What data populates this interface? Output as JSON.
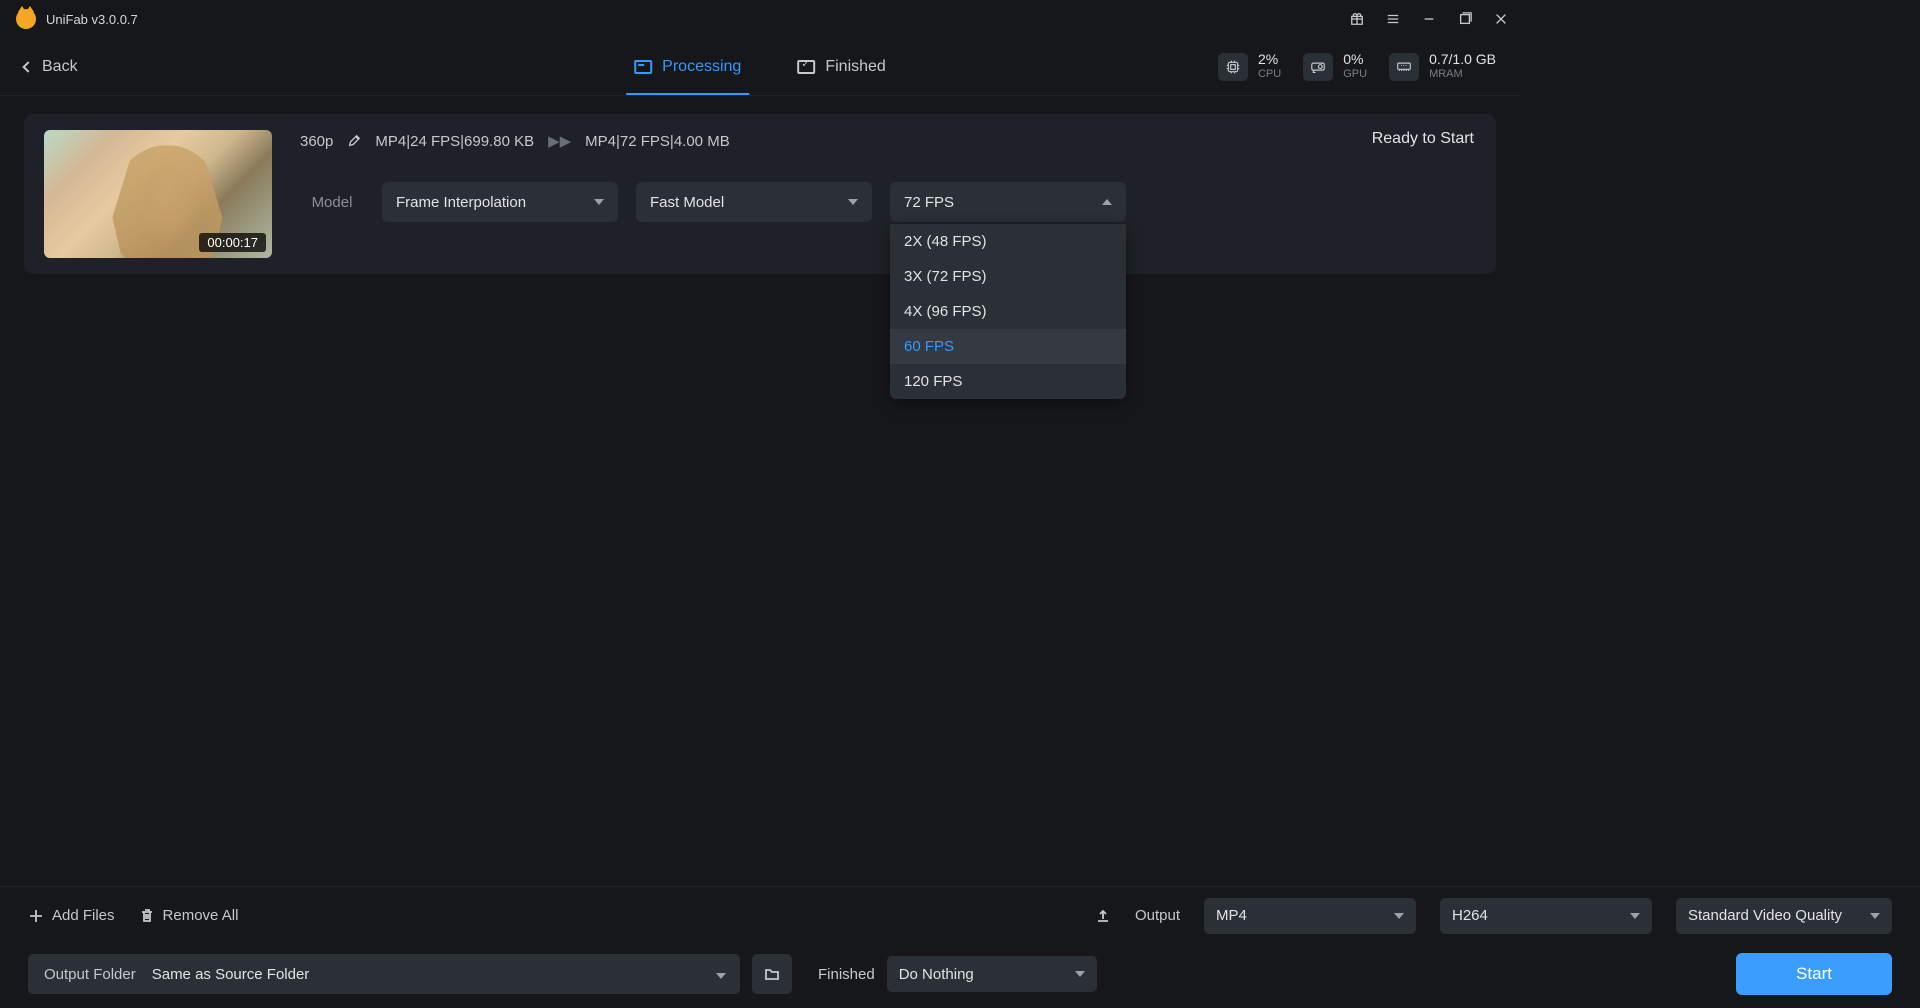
{
  "app_title": "UniFab v3.0.0.7",
  "titlebar_controls": {
    "menu": "≡",
    "minimize": "—",
    "maximize": "⧉",
    "close": "✕"
  },
  "back_label": "Back",
  "tabs": {
    "processing": "Processing",
    "finished": "Finished"
  },
  "stats": {
    "cpu": {
      "value": "2%",
      "label": "CPU"
    },
    "gpu": {
      "value": "0%",
      "label": "GPU"
    },
    "ram": {
      "value": "0.7/1.0 GB",
      "label": "MRAM"
    }
  },
  "card": {
    "duration": "00:00:17",
    "resolution": "360p",
    "source_spec": "MP4|24 FPS|699.80 KB",
    "arrow": "▶▶",
    "target_spec": "MP4|72 FPS|4.00 MB",
    "status": "Ready to Start",
    "model_label": "Model",
    "model_select": "Frame Interpolation",
    "speed_select": "Fast Model",
    "fps_select": "72 FPS",
    "fps_options": [
      "2X (48 FPS)",
      "3X (72 FPS)",
      "4X (96 FPS)",
      "60 FPS",
      "120 FPS"
    ],
    "fps_highlighted_index": 3
  },
  "footer1": {
    "add_files": "Add Files",
    "remove_all": "Remove All",
    "output_label": "Output",
    "format": "MP4",
    "codec": "H264",
    "quality": "Standard Video Quality"
  },
  "footer2": {
    "output_folder_label": "Output Folder",
    "output_folder_value": "Same as Source Folder",
    "finished_label": "Finished",
    "finished_action": "Do Nothing",
    "start": "Start"
  }
}
